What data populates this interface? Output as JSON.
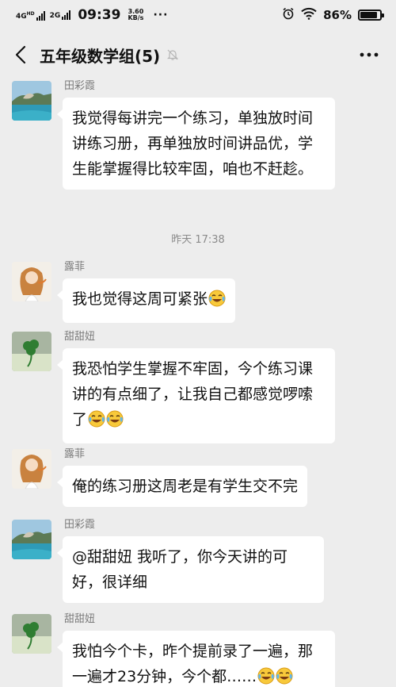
{
  "status_bar": {
    "network_1": "4G",
    "network_1_sub": "HD",
    "network_2": "2G",
    "time": "09:39",
    "speed_value": "3.60",
    "speed_unit": "KB/s",
    "more": "···",
    "battery_percent": "86%",
    "battery_level": 0.86
  },
  "nav": {
    "title": "五年级数学组(5)",
    "back_icon": "chevron-left-icon",
    "mute_icon": "bell-off-icon",
    "more_icon": "more-dots-icon"
  },
  "timestamp": "昨天 17:38",
  "messages": [
    {
      "sender": "田彩霞",
      "text": "我觉得每讲完一个练习，单独放时间讲练习册，再单独放时间讲品优，学生能掌握得比较牢固，咱也不赶趁。",
      "emoji_count": 0
    },
    {
      "sender": "露菲",
      "text": "我也觉得这周可紧张",
      "emoji_count": 1
    },
    {
      "sender": "甜甜妞",
      "text": "我恐怕学生掌握不牢固，今个练习课讲的有点细了，让我自己都感觉啰嗦了",
      "emoji_count": 2
    },
    {
      "sender": "露菲",
      "text": "俺的练习册这周老是有学生交不完",
      "emoji_count": 0
    },
    {
      "sender": "田彩霞",
      "text": "@甜甜妞  我听了，你今天讲的可好，很详细",
      "emoji_count": 0
    },
    {
      "sender": "甜甜妞",
      "text": "我怕今个卡，昨个提前录了一遍，那一遍才23分钟，今个都……",
      "emoji_count": 2
    }
  ],
  "emoji_name": "laugh-cry-emoji",
  "colors": {
    "background": "#ededed",
    "bubble": "#ffffff",
    "sender_text": "#7b7b7b"
  }
}
